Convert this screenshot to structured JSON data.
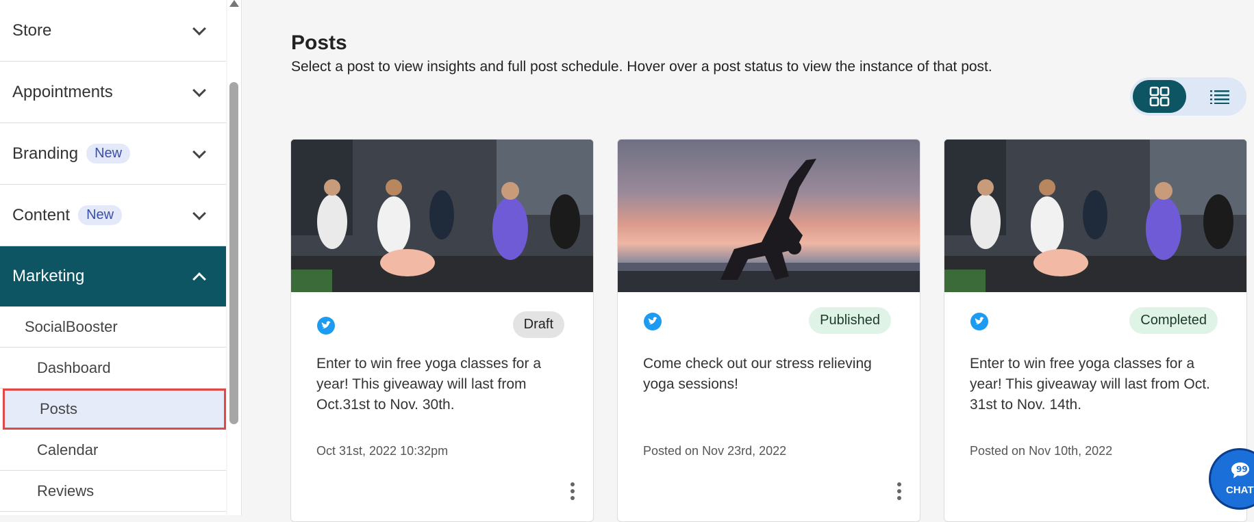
{
  "sidebar": {
    "items": [
      {
        "label": "Store",
        "badge": ""
      },
      {
        "label": "Appointments",
        "badge": ""
      },
      {
        "label": "Branding",
        "badge": "New"
      },
      {
        "label": "Content",
        "badge": "New"
      },
      {
        "label": "Marketing",
        "badge": ""
      }
    ],
    "marketing_sub": {
      "group": "SocialBooster",
      "items": [
        "Dashboard",
        "Posts",
        "Calendar",
        "Reviews"
      ]
    }
  },
  "main": {
    "title": "Posts",
    "subtitle": "Select a post to view insights and full post schedule. Hover over a post status to view the instance of that post."
  },
  "cards": [
    {
      "status": "Draft",
      "text": "Enter to win free yoga classes for a year! This giveaway will last from Oct.31st to Nov. 30th.",
      "date": "Oct 31st, 2022 10:32pm"
    },
    {
      "status": "Published",
      "text": "Come check out our stress relieving yoga sessions!",
      "date": "Posted on Nov 23rd, 2022"
    },
    {
      "status": "Completed",
      "text": "Enter to win free yoga classes for a year! This giveaway will last from Oct. 31st to Nov. 14th.",
      "date": "Posted on Nov 10th, 2022"
    }
  ],
  "chat": {
    "label": "CHAT"
  },
  "colors": {
    "accent": "#0d5563",
    "selected_bg": "#e6ebfa",
    "highlight": "#e04848",
    "twitter": "#1d9bf0"
  },
  "icons": {
    "view_grid": "grid-view-icon",
    "view_list": "list-view-icon",
    "social": "twitter-icon",
    "more": "more-vertical-icon",
    "chat": "chat-icon"
  }
}
